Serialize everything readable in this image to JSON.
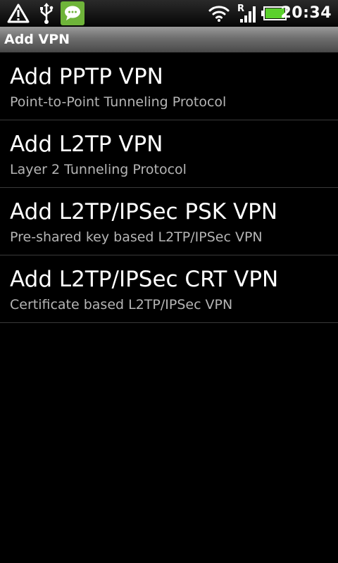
{
  "status_bar": {
    "time": "20:34",
    "icons": [
      "warning-icon",
      "usb-icon",
      "message-notification-icon",
      "wifi-icon",
      "roaming-signal-icon",
      "battery-icon"
    ],
    "notification_color": "#6fb43a",
    "battery_color": "#5bd12d"
  },
  "header": {
    "title": "Add VPN"
  },
  "vpn_options": [
    {
      "title": "Add PPTP VPN",
      "subtitle": "Point-to-Point Tunneling Protocol"
    },
    {
      "title": "Add L2TP VPN",
      "subtitle": "Layer 2 Tunneling Protocol"
    },
    {
      "title": "Add L2TP/IPSec PSK VPN",
      "subtitle": "Pre-shared key based L2TP/IPSec VPN"
    },
    {
      "title": "Add L2TP/IPSec CRT VPN",
      "subtitle": "Certificate based L2TP/IPSec VPN"
    }
  ]
}
